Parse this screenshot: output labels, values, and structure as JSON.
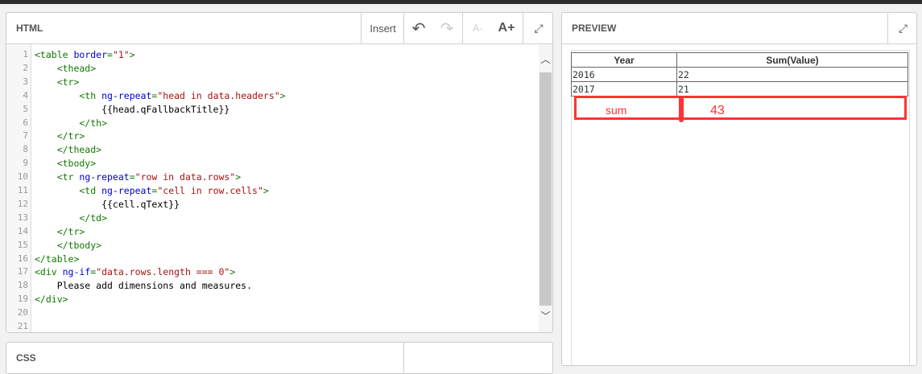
{
  "html_panel": {
    "title": "HTML",
    "insert": "Insert",
    "font_down": "A-",
    "font_up": "A+",
    "lines": [
      [
        [
          "t-tag",
          "<table "
        ],
        [
          "t-attr",
          "border"
        ],
        [
          "t-tag",
          "="
        ],
        [
          "t-str",
          "\"1\""
        ],
        [
          "t-tag",
          ">"
        ]
      ],
      [
        [
          "t-tag",
          "    <thead>"
        ]
      ],
      [
        [
          "t-tag",
          "    <tr>"
        ]
      ],
      [
        [
          "t-tag",
          "        <th "
        ],
        [
          "t-attr",
          "ng-repeat"
        ],
        [
          "t-tag",
          "="
        ],
        [
          "t-str",
          "\"head in data.headers\""
        ],
        [
          "t-tag",
          ">"
        ]
      ],
      [
        [
          "t-text",
          "            {{head.qFallbackTitle}}"
        ]
      ],
      [
        [
          "t-tag",
          "        </th>"
        ]
      ],
      [
        [
          "t-tag",
          "    </tr>"
        ]
      ],
      [
        [
          "t-tag",
          "    </thead>"
        ]
      ],
      [
        [
          "t-tag",
          "    <tbody>"
        ]
      ],
      [
        [
          "t-tag",
          "    <tr "
        ],
        [
          "t-attr",
          "ng-repeat"
        ],
        [
          "t-tag",
          "="
        ],
        [
          "t-str",
          "\"row in data.rows\""
        ],
        [
          "t-tag",
          ">"
        ]
      ],
      [
        [
          "t-tag",
          "        <td "
        ],
        [
          "t-attr",
          "ng-repeat"
        ],
        [
          "t-tag",
          "="
        ],
        [
          "t-str",
          "\"cell in row.cells\""
        ],
        [
          "t-tag",
          ">"
        ]
      ],
      [
        [
          "t-text",
          "            {{cell.qText}}"
        ]
      ],
      [
        [
          "t-tag",
          "        </td>"
        ]
      ],
      [
        [
          "t-tag",
          "    </tr>"
        ]
      ],
      [
        [
          "t-tag",
          "    </tbody>"
        ]
      ],
      [
        [
          "t-tag",
          "</table>"
        ]
      ],
      [
        [
          "t-tag",
          "<div "
        ],
        [
          "t-attr",
          "ng-if"
        ],
        [
          "t-tag",
          "="
        ],
        [
          "t-str",
          "\"data.rows.length === 0\""
        ],
        [
          "t-tag",
          ">"
        ]
      ],
      [
        [
          "t-text",
          "    Please add dimensions and measures."
        ]
      ],
      [
        [
          "t-tag",
          "</div>"
        ]
      ],
      [],
      []
    ]
  },
  "preview_panel": {
    "title": "PREVIEW",
    "headers": [
      "Year",
      "Sum(Value)"
    ],
    "rows": [
      [
        "2016",
        "22"
      ],
      [
        "2017",
        "21"
      ]
    ],
    "annotation": {
      "label": "sum",
      "value": "43"
    }
  },
  "css_panel": {
    "title": "CSS"
  }
}
